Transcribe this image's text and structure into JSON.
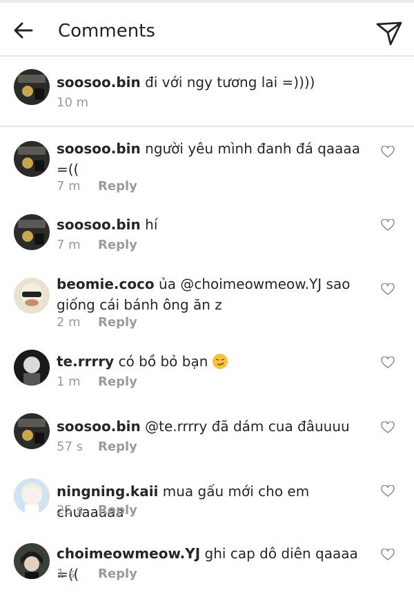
{
  "header": {
    "title": "Comments",
    "back_icon": "arrow-left-icon",
    "send_icon": "paper-plane-icon"
  },
  "caption": {
    "username": "soosoo.bin",
    "text": " đi với ngy tương lai =))))",
    "time": "10 m"
  },
  "comments": [
    {
      "username": "soosoo.bin",
      "text": " người yêu mình đanh đá qaaaa =((",
      "time": "7 m",
      "reply": "Reply"
    },
    {
      "username": "soosoo.bin",
      "text": " hí",
      "time": "7 m",
      "reply": "Reply"
    },
    {
      "username": "beomie.coco",
      "text": " ủa @choimeowmeow.YJ sao giống cái bánh ông ăn z",
      "time": "2 m",
      "reply": "Reply"
    },
    {
      "username": "te.rrrry",
      "text": " có bồ bỏ bạn ",
      "emoji": "smirk-emoji",
      "time": "1 m",
      "reply": "Reply"
    },
    {
      "username": "soosoo.bin",
      "text": " @te.rrrry đã dám cua đâuuuu",
      "time": "57 s",
      "reply": "Reply"
    },
    {
      "username": "ningning.kaii",
      "text": " mua gấu mới cho em chưaaaaa",
      "time": "25 s",
      "reply": "Reply"
    },
    {
      "username": "choimeowmeow.YJ",
      "text": " ghi cap dô diên qaaaa =((",
      "time": "1 s",
      "reply": "Reply"
    }
  ],
  "colors": {
    "text": "#262626",
    "meta": "#9a9a9a",
    "divider": "#e6e6e6"
  }
}
